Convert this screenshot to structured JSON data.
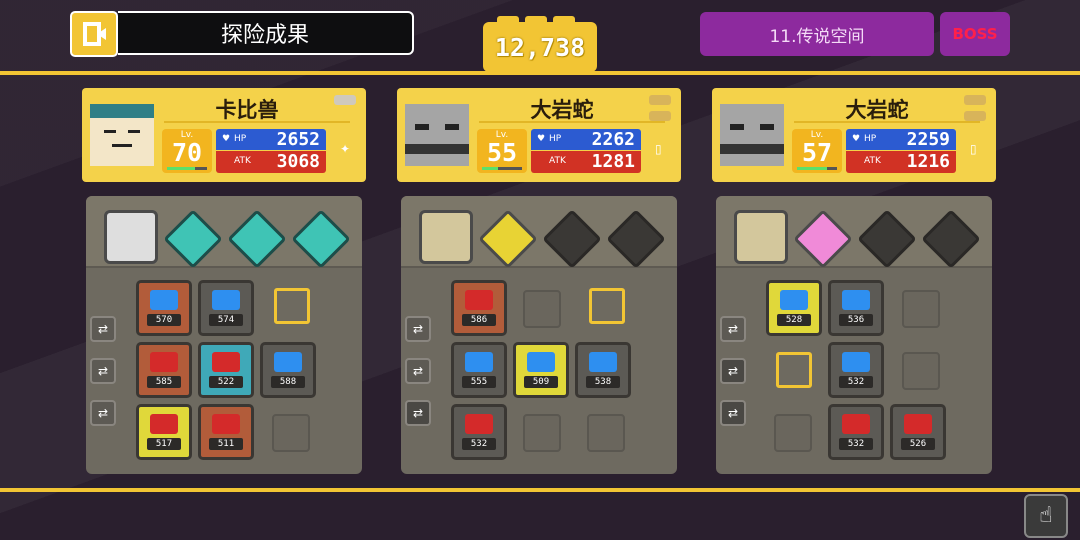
{
  "header": {
    "title": "探险成果",
    "coins": "12,738",
    "stage": "11.传说空间",
    "boss": "BOSS"
  },
  "pokemon": [
    {
      "name": "卡比兽",
      "lv_label": "Lv.",
      "lv": "70",
      "hp_label": "HP",
      "hp": "2652",
      "atk_label": "ATK",
      "atk": "3068",
      "portrait_color": "#8dcfc9"
    },
    {
      "name": "大岩蛇",
      "lv_label": "Lv.",
      "lv": "55",
      "hp_label": "HP",
      "hp": "2262",
      "atk_label": "ATK",
      "atk": "1281",
      "portrait_color": "#9e9e9e"
    },
    {
      "name": "大岩蛇",
      "lv_label": "Lv.",
      "lv": "57",
      "hp_label": "HP",
      "hp": "2259",
      "atk_label": "ATK",
      "atk": "1216",
      "portrait_color": "#9e9e9e"
    }
  ],
  "stones": {
    "p1": [
      "570",
      "574",
      "585",
      "522",
      "588",
      "517",
      "511"
    ],
    "p2": [
      "586",
      "555",
      "509",
      "538",
      "532"
    ],
    "p3": [
      "528",
      "536",
      "532",
      "532",
      "526"
    ]
  },
  "icons": {
    "exit": "exit-door-icon",
    "hand": "hand-pointer-icon",
    "swap": "swap-icon"
  },
  "colors": {
    "yellow": "#f2c534",
    "purple": "#8d2a9e",
    "hp": "#2c5bd1",
    "atk": "#d13224"
  }
}
